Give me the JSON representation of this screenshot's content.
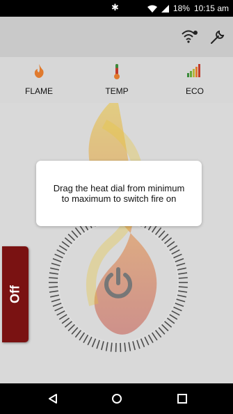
{
  "status_bar": {
    "battery": "18%",
    "time": "10:15 am",
    "icons": [
      "bluetooth-icon",
      "wifi-signal-icon",
      "cell-signal-icon"
    ]
  },
  "app_bar": {
    "icons": [
      "wifi-settings-icon",
      "wrench-icon"
    ]
  },
  "tabs": [
    {
      "label": "FLAME",
      "icon": "flame-icon",
      "selected": true
    },
    {
      "label": "TEMP",
      "icon": "thermometer-icon",
      "selected": false
    },
    {
      "label": "ECO",
      "icon": "eco-bars-icon",
      "selected": false
    }
  ],
  "tooltip": {
    "text": "Drag the heat dial from minimum to maximum to switch fire on"
  },
  "off_switch": {
    "label": "Off"
  },
  "power_button": {
    "icon": "power-icon"
  },
  "nav_bar": {
    "icons": [
      "back-icon",
      "home-icon",
      "recents-icon"
    ]
  },
  "colors": {
    "accent": "#2c6e78",
    "off_switch": "#7a1212",
    "flame_orange": "#e07a2e",
    "flame_yellow": "#e9c63a"
  }
}
